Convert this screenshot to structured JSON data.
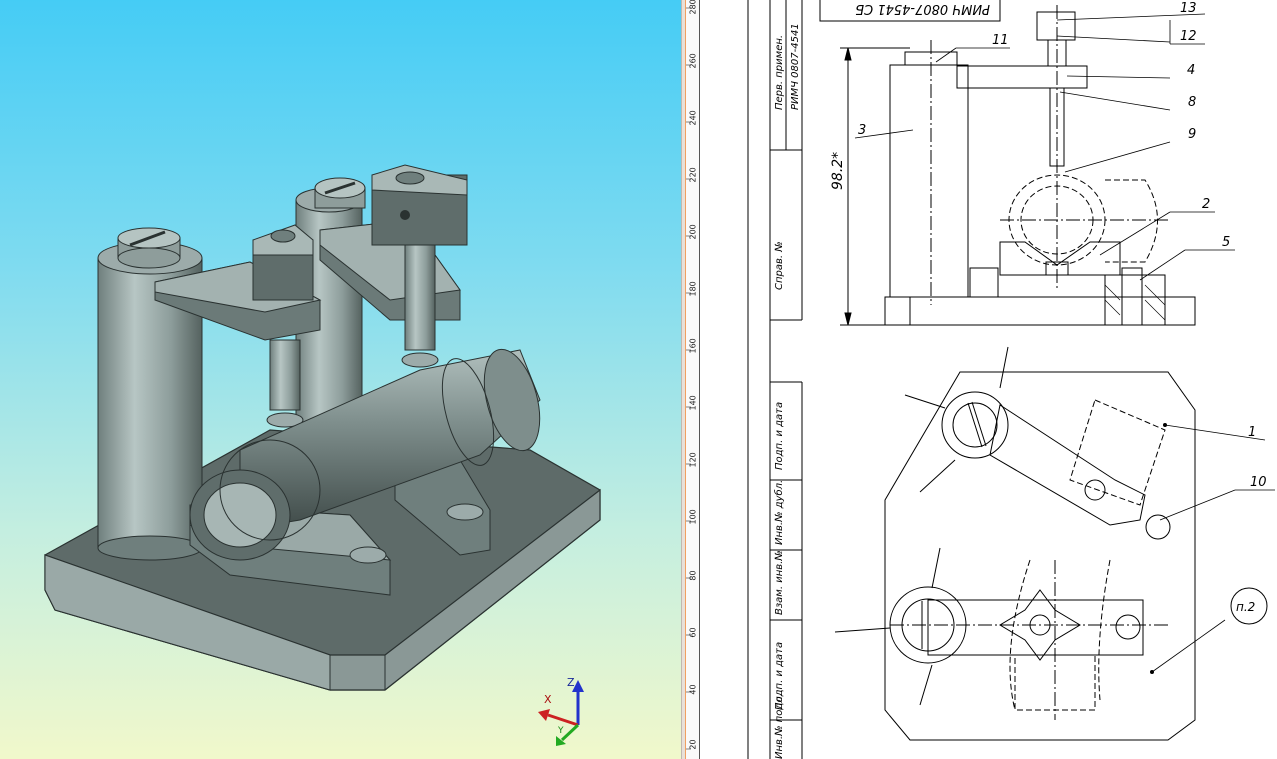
{
  "ruler": {
    "marks": [
      "280",
      "260",
      "240",
      "220",
      "200",
      "180",
      "160",
      "140",
      "120",
      "100",
      "80",
      "60",
      "40",
      "20"
    ]
  },
  "axes": {
    "x_label": "X",
    "y_label": "Y",
    "z_label": "Z"
  },
  "drawing": {
    "designation": "РИМЧ 0807-4541 СБ",
    "side_block": {
      "perv_primen": "Перв. примен.",
      "perv_primen_value": "РИМЧ 0807-4541",
      "sprav_no": "Справ. №",
      "podp_data_1": "Подп. и дата",
      "inv_dubl": "Инв.№ дубл.",
      "vzam_inv": "Взам. инв.№",
      "podp_data_2": "Подп. и дата",
      "inv_podl": "Инв.№ подл."
    },
    "dimension": "98.2*",
    "callouts": [
      "1",
      "2",
      "3",
      "4",
      "5",
      "8",
      "9",
      "10",
      "11",
      "12",
      "13"
    ],
    "note": "п.2"
  },
  "colors": {
    "metal": "#8a9a98",
    "metal_dark": "#4f5b5a",
    "metal_light": "#b5c4c2",
    "line": "#000000",
    "accent": "#f0a060"
  }
}
